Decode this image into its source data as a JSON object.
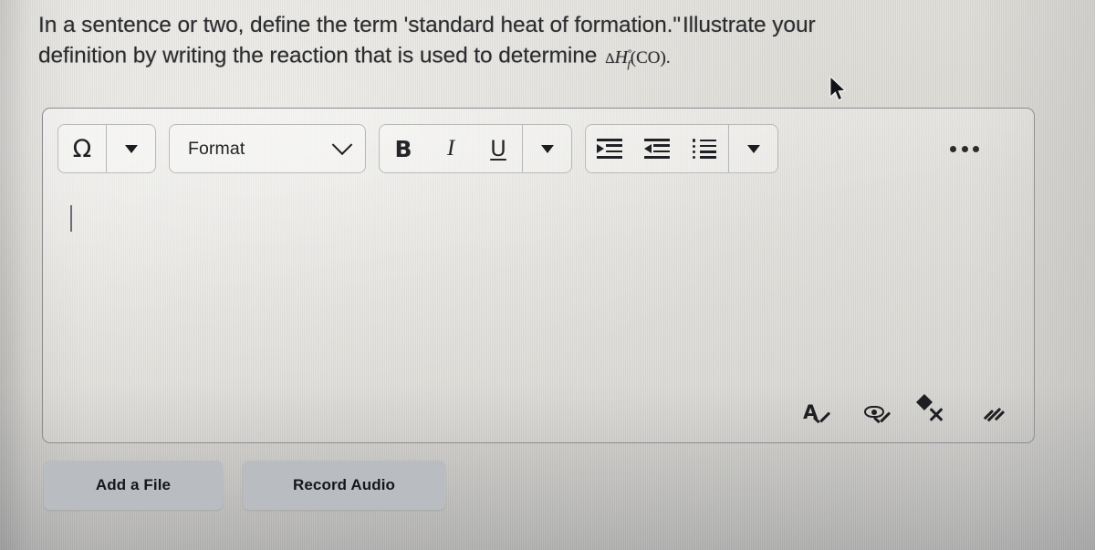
{
  "question": {
    "line1": "In a sentence or two, define the term 'standard heat of formation.\"",
    "line1_tail": "Illustrate your",
    "line2": "definition by writing the reaction that is used to determine",
    "formula": {
      "delta": "Δ",
      "h": "H",
      "superscript": "°",
      "subscript": "f",
      "species": "(CO)",
      "period": ".",
      "plain_text": "ΔH°f(CO)."
    }
  },
  "editor": {
    "toolbar": {
      "groups": [
        {
          "name": "special-characters",
          "buttons": [
            {
              "label": "Ω",
              "icon": "omega-icon",
              "name": "insert-special-character-button"
            },
            {
              "label": "",
              "icon": "caret-down-icon",
              "name": "special-character-menu-button"
            }
          ]
        },
        {
          "name": "format",
          "buttons": [
            {
              "label": "Format",
              "icon": "chevron-down-icon",
              "name": "format-dropdown"
            }
          ]
        },
        {
          "name": "text-style",
          "buttons": [
            {
              "label": "B",
              "icon": "bold-icon",
              "name": "bold-button"
            },
            {
              "label": "I",
              "icon": "italic-icon",
              "name": "italic-button"
            },
            {
              "label": "U",
              "icon": "underline-icon",
              "name": "underline-button"
            },
            {
              "label": "",
              "icon": "caret-down-icon",
              "name": "text-style-menu-button"
            }
          ]
        },
        {
          "name": "lists-and-indent",
          "buttons": [
            {
              "label": "",
              "icon": "indent-increase-icon",
              "name": "increase-indent-button"
            },
            {
              "label": "",
              "icon": "indent-decrease-icon",
              "name": "decrease-indent-button"
            },
            {
              "label": "",
              "icon": "bulleted-list-icon",
              "name": "bulleted-list-button"
            },
            {
              "label": "",
              "icon": "caret-down-icon",
              "name": "list-menu-button"
            }
          ]
        }
      ],
      "overflow_label": "•••",
      "overflow_name": "more-options-button"
    },
    "body": {
      "content": "",
      "placeholder": "",
      "caret_visible": true
    },
    "status_icons": [
      {
        "icon": "spell-check-icon",
        "name": "spell-checker-button",
        "label": "A"
      },
      {
        "icon": "accessibility-checker-icon",
        "name": "accessibility-checker-button",
        "label": ""
      },
      {
        "icon": "expand-icon",
        "name": "fullscreen-button",
        "label": ""
      },
      {
        "icon": "resize-handle-icon",
        "name": "resize-handle",
        "label": ""
      }
    ]
  },
  "actions": {
    "add_file": "Add a File",
    "record_audio": "Record Audio"
  },
  "pointer": {
    "icon": "mouse-arrow-cursor"
  },
  "colors": {
    "screen_background": "#dedcd7",
    "text": "#2b2c2e",
    "frame_border": "#8b8d90",
    "button_background": "#b9bcc0",
    "icon": "#1e1f22"
  }
}
